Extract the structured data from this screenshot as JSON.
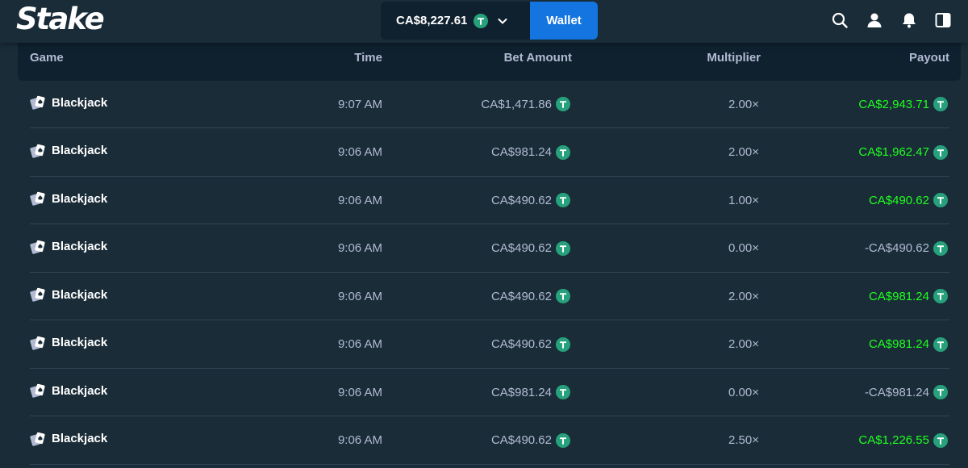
{
  "header": {
    "logo": "Stake",
    "balance": "CA$8,227.61",
    "wallet_label": "Wallet",
    "icons": [
      "search-icon",
      "user-icon",
      "bell-icon",
      "sidebar-toggle-icon"
    ]
  },
  "table": {
    "columns": {
      "game": "Game",
      "time": "Time",
      "bet": "Bet Amount",
      "multiplier": "Multiplier",
      "payout": "Payout"
    },
    "rows": [
      {
        "game": "Blackjack",
        "time": "9:07 AM",
        "bet": "CA$1,471.86",
        "multiplier": "2.00×",
        "payout": "CA$2,943.71",
        "win": true
      },
      {
        "game": "Blackjack",
        "time": "9:06 AM",
        "bet": "CA$981.24",
        "multiplier": "2.00×",
        "payout": "CA$1,962.47",
        "win": true
      },
      {
        "game": "Blackjack",
        "time": "9:06 AM",
        "bet": "CA$490.62",
        "multiplier": "1.00×",
        "payout": "CA$490.62",
        "win": true
      },
      {
        "game": "Blackjack",
        "time": "9:06 AM",
        "bet": "CA$490.62",
        "multiplier": "0.00×",
        "payout": "-CA$490.62",
        "win": false
      },
      {
        "game": "Blackjack",
        "time": "9:06 AM",
        "bet": "CA$490.62",
        "multiplier": "2.00×",
        "payout": "CA$981.24",
        "win": true
      },
      {
        "game": "Blackjack",
        "time": "9:06 AM",
        "bet": "CA$490.62",
        "multiplier": "2.00×",
        "payout": "CA$981.24",
        "win": true
      },
      {
        "game": "Blackjack",
        "time": "9:06 AM",
        "bet": "CA$981.24",
        "multiplier": "0.00×",
        "payout": "-CA$981.24",
        "win": false
      },
      {
        "game": "Blackjack",
        "time": "9:06 AM",
        "bet": "CA$490.62",
        "multiplier": "2.50×",
        "payout": "CA$1,226.55",
        "win": true
      }
    ]
  },
  "colors": {
    "background": "#1a2c38",
    "panel": "#0f212e",
    "accent_blue": "#1475e1",
    "win_green": "#1fff20",
    "muted_text": "#b1bad3",
    "tether_green": "#26a17b"
  },
  "currency_icon": "tether-coin-icon"
}
